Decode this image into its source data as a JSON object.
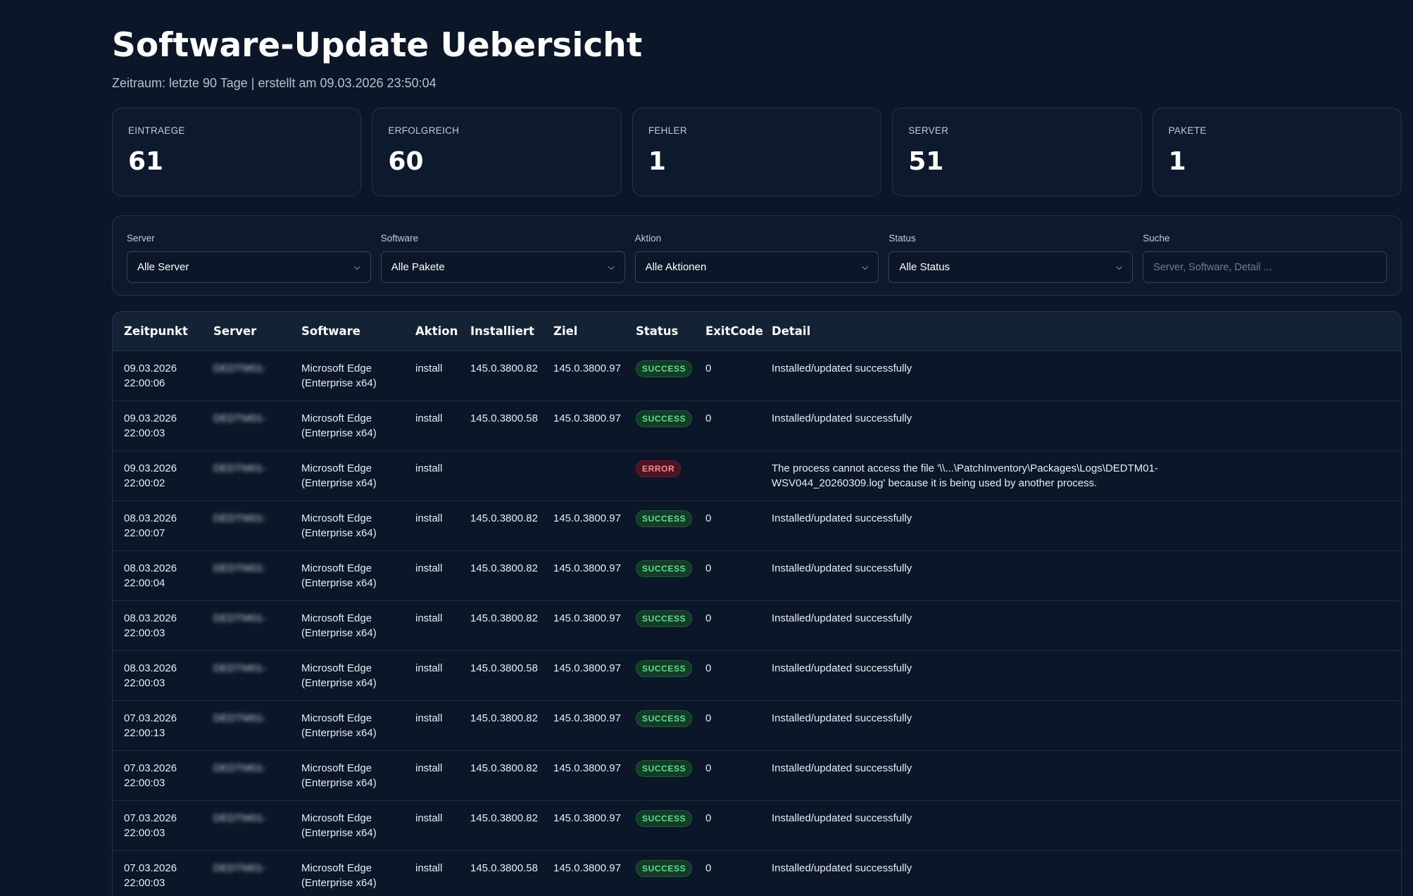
{
  "header": {
    "title": "Software-Update Uebersicht",
    "subtitle": "Zeitraum: letzte 90 Tage | erstellt am 09.03.2026 23:50:04"
  },
  "cards": [
    {
      "label": "EINTRAEGE",
      "value": "61"
    },
    {
      "label": "ERFOLGREICH",
      "value": "60"
    },
    {
      "label": "FEHLER",
      "value": "1"
    },
    {
      "label": "SERVER",
      "value": "51"
    },
    {
      "label": "PAKETE",
      "value": "1"
    }
  ],
  "filters": {
    "server": {
      "label": "Server",
      "value": "Alle Server"
    },
    "software": {
      "label": "Software",
      "value": "Alle Pakete"
    },
    "action": {
      "label": "Aktion",
      "value": "Alle Aktionen"
    },
    "status": {
      "label": "Status",
      "value": "Alle Status"
    },
    "search": {
      "label": "Suche",
      "placeholder": "Server, Software, Detail ..."
    }
  },
  "table": {
    "headers": [
      "Zeitpunkt",
      "Server",
      "Software",
      "Aktion",
      "Installiert",
      "Ziel",
      "Status",
      "ExitCode",
      "Detail"
    ],
    "rows": [
      {
        "date": "09.03.2026",
        "time": "22:00:06",
        "server": "DEDTM01-",
        "software": "Microsoft Edge",
        "software2": "(Enterprise x64)",
        "action": "install",
        "installed": "145.0.3800.82",
        "target": "145.0.3800.97",
        "status": "SUCCESS",
        "exit": "0",
        "detail": "Installed/updated successfully",
        "detail2": ""
      },
      {
        "date": "09.03.2026",
        "time": "22:00:03",
        "server": "DEDTM01-",
        "software": "Microsoft Edge",
        "software2": "(Enterprise x64)",
        "action": "install",
        "installed": "145.0.3800.58",
        "target": "145.0.3800.97",
        "status": "SUCCESS",
        "exit": "0",
        "detail": "Installed/updated successfully",
        "detail2": ""
      },
      {
        "date": "09.03.2026",
        "time": "22:00:02",
        "server": "DEDTM01-",
        "software": "Microsoft Edge",
        "software2": "(Enterprise x64)",
        "action": "install",
        "installed": "",
        "target": "",
        "status": "ERROR",
        "exit": "",
        "detail": "The process cannot access the file '\\\\...\\PatchInventory\\Packages\\Logs\\DEDTM01-",
        "detail2": "WSV044_20260309.log' because it is being used by another process."
      },
      {
        "date": "08.03.2026",
        "time": "22:00:07",
        "server": "DEDTM01-",
        "software": "Microsoft Edge",
        "software2": "(Enterprise x64)",
        "action": "install",
        "installed": "145.0.3800.82",
        "target": "145.0.3800.97",
        "status": "SUCCESS",
        "exit": "0",
        "detail": "Installed/updated successfully",
        "detail2": ""
      },
      {
        "date": "08.03.2026",
        "time": "22:00:04",
        "server": "DEDTM01-",
        "software": "Microsoft Edge",
        "software2": "(Enterprise x64)",
        "action": "install",
        "installed": "145.0.3800.82",
        "target": "145.0.3800.97",
        "status": "SUCCESS",
        "exit": "0",
        "detail": "Installed/updated successfully",
        "detail2": ""
      },
      {
        "date": "08.03.2026",
        "time": "22:00:03",
        "server": "DEDTM01-",
        "software": "Microsoft Edge",
        "software2": "(Enterprise x64)",
        "action": "install",
        "installed": "145.0.3800.82",
        "target": "145.0.3800.97",
        "status": "SUCCESS",
        "exit": "0",
        "detail": "Installed/updated successfully",
        "detail2": ""
      },
      {
        "date": "08.03.2026",
        "time": "22:00:03",
        "server": "DEDTM01-",
        "software": "Microsoft Edge",
        "software2": "(Enterprise x64)",
        "action": "install",
        "installed": "145.0.3800.58",
        "target": "145.0.3800.97",
        "status": "SUCCESS",
        "exit": "0",
        "detail": "Installed/updated successfully",
        "detail2": ""
      },
      {
        "date": "07.03.2026",
        "time": "22:00:13",
        "server": "DEDTM01-",
        "software": "Microsoft Edge",
        "software2": "(Enterprise x64)",
        "action": "install",
        "installed": "145.0.3800.82",
        "target": "145.0.3800.97",
        "status": "SUCCESS",
        "exit": "0",
        "detail": "Installed/updated successfully",
        "detail2": ""
      },
      {
        "date": "07.03.2026",
        "time": "22:00:03",
        "server": "DEDTM01-",
        "software": "Microsoft Edge",
        "software2": "(Enterprise x64)",
        "action": "install",
        "installed": "145.0.3800.82",
        "target": "145.0.3800.97",
        "status": "SUCCESS",
        "exit": "0",
        "detail": "Installed/updated successfully",
        "detail2": ""
      },
      {
        "date": "07.03.2026",
        "time": "22:00:03",
        "server": "DEDTM01-",
        "software": "Microsoft Edge",
        "software2": "(Enterprise x64)",
        "action": "install",
        "installed": "145.0.3800.82",
        "target": "145.0.3800.97",
        "status": "SUCCESS",
        "exit": "0",
        "detail": "Installed/updated successfully",
        "detail2": ""
      },
      {
        "date": "07.03.2026",
        "time": "22:00:03",
        "server": "DEDTM01-",
        "software": "Microsoft Edge",
        "software2": "(Enterprise x64)",
        "action": "install",
        "installed": "145.0.3800.58",
        "target": "145.0.3800.97",
        "status": "SUCCESS",
        "exit": "0",
        "detail": "Installed/updated successfully",
        "detail2": ""
      }
    ]
  },
  "colors": {
    "background": "#0b1628",
    "card": "#0d1a2e",
    "success": "#5ee08d",
    "error": "#ff8a96"
  }
}
